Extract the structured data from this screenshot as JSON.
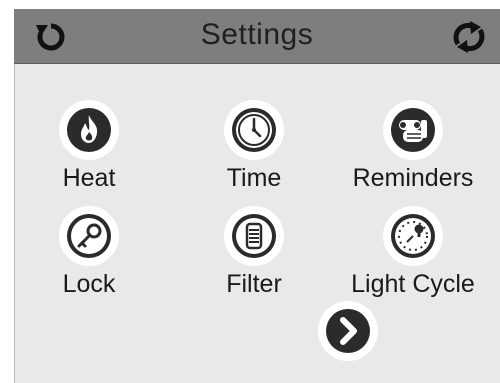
{
  "header": {
    "title": "Settings",
    "left_icon": "back-rotate-icon",
    "right_icon": "sync-arrows-icon"
  },
  "items": [
    {
      "label": "Heat",
      "icon": "flame-icon"
    },
    {
      "label": "Time",
      "icon": "clock-icon"
    },
    {
      "label": "Reminders",
      "icon": "reminder-hand-icon"
    },
    {
      "label": "Lock",
      "icon": "key-icon"
    },
    {
      "label": "Filter",
      "icon": "filter-icon"
    },
    {
      "label": "Light Cycle",
      "icon": "light-cycle-icon"
    }
  ],
  "next": {
    "icon": "chevron-right-icon"
  },
  "colors": {
    "header": "#7e7e7f",
    "panel": "#e9e9ea",
    "icon_dark": "#2b2b2b"
  }
}
